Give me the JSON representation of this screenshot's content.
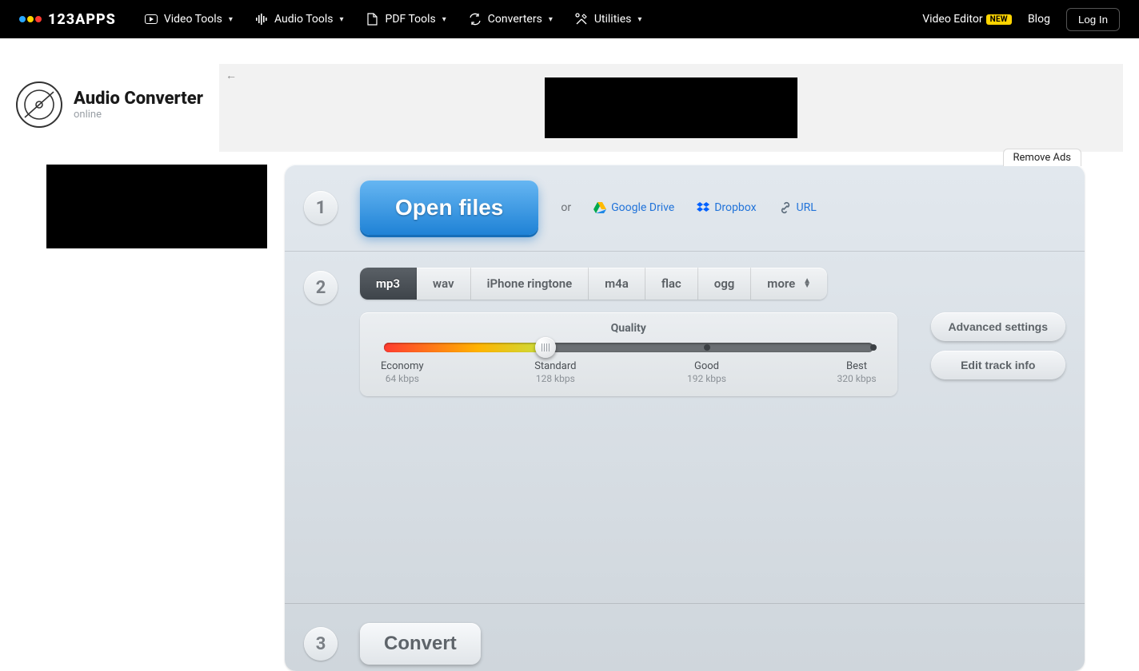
{
  "brand": {
    "name": "123APPS",
    "dot_colors": [
      "#2aa8ff",
      "#ffd400",
      "#ff3b30"
    ]
  },
  "nav": {
    "items": [
      {
        "label": "Video Tools"
      },
      {
        "label": "Audio Tools"
      },
      {
        "label": "PDF Tools"
      },
      {
        "label": "Converters"
      },
      {
        "label": "Utilities"
      }
    ]
  },
  "topbar_right": {
    "video_editor": "Video Editor",
    "new_badge": "NEW",
    "blog": "Blog",
    "login": "Log In"
  },
  "app": {
    "title": "Audio Converter",
    "subtitle": "online"
  },
  "remove_ads_label": "Remove Ads",
  "step1": {
    "number": "1",
    "open_files": "Open files",
    "or": "or",
    "sources": {
      "google_drive": "Google Drive",
      "dropbox": "Dropbox",
      "url": "URL"
    }
  },
  "step2": {
    "number": "2",
    "formats": [
      "mp3",
      "wav",
      "iPhone ringtone",
      "m4a",
      "flac",
      "ogg",
      "more"
    ],
    "active_format_index": 0,
    "quality_title": "Quality",
    "quality_stops": [
      {
        "name": "Economy",
        "rate": "64 kbps"
      },
      {
        "name": "Standard",
        "rate": "128 kbps"
      },
      {
        "name": "Good",
        "rate": "192 kbps"
      },
      {
        "name": "Best",
        "rate": "320 kbps"
      }
    ],
    "selected_stop_index": 1,
    "advanced_settings": "Advanced settings",
    "edit_track_info": "Edit track info"
  },
  "step3": {
    "number": "3",
    "convert": "Convert"
  }
}
